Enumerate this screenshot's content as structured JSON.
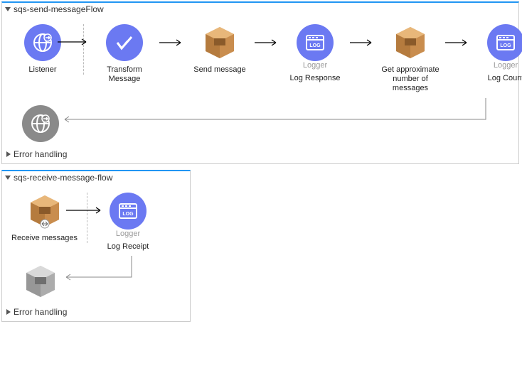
{
  "flows": [
    {
      "title": "sqs-send-messageFlow",
      "source": {
        "label": "Listener"
      },
      "nodes": [
        {
          "label": "Transform Message",
          "type": "transform"
        },
        {
          "label": "Send message",
          "type": "sqs"
        },
        {
          "subLabel": "Logger",
          "label": "Log Response",
          "type": "logger"
        },
        {
          "label": "Get approximate number of messages",
          "type": "sqs"
        },
        {
          "subLabel": "Logger",
          "label": "Log Count",
          "type": "logger"
        }
      ],
      "errorLabel": "Error handling"
    },
    {
      "title": "sqs-receive-message-flow",
      "source": {
        "label": "Receive messages"
      },
      "nodes": [
        {
          "subLabel": "Logger",
          "label": "Log Receipt",
          "type": "logger"
        }
      ],
      "errorLabel": "Error handling"
    }
  ]
}
